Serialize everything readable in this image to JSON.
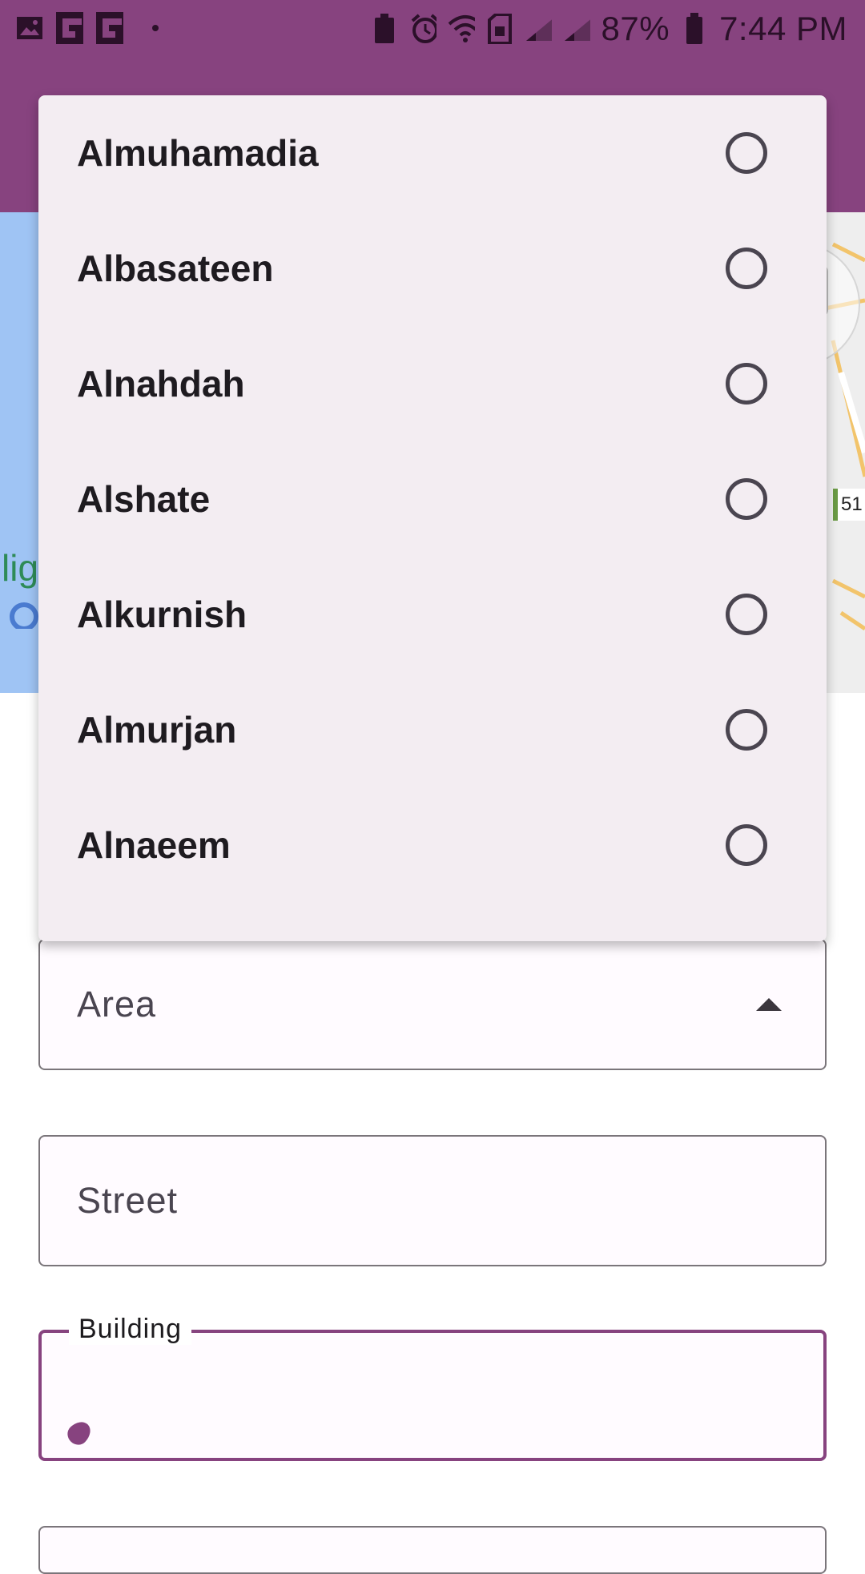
{
  "status_bar": {
    "battery": "87%",
    "time": "7:44 PM"
  },
  "map": {
    "route_marker": "51"
  },
  "dropdown": {
    "options": [
      {
        "label": "Almuhamadia"
      },
      {
        "label": "Albasateen"
      },
      {
        "label": "Alnahdah"
      },
      {
        "label": "Alshate"
      },
      {
        "label": "Alkurnish"
      },
      {
        "label": "Almurjan"
      },
      {
        "label": "Alnaeem"
      }
    ]
  },
  "form": {
    "area_label": "Area",
    "street_label": "Street",
    "building_label": "Building"
  },
  "colors": {
    "primary": "#87437f",
    "menu_bg": "#f3edf2"
  }
}
